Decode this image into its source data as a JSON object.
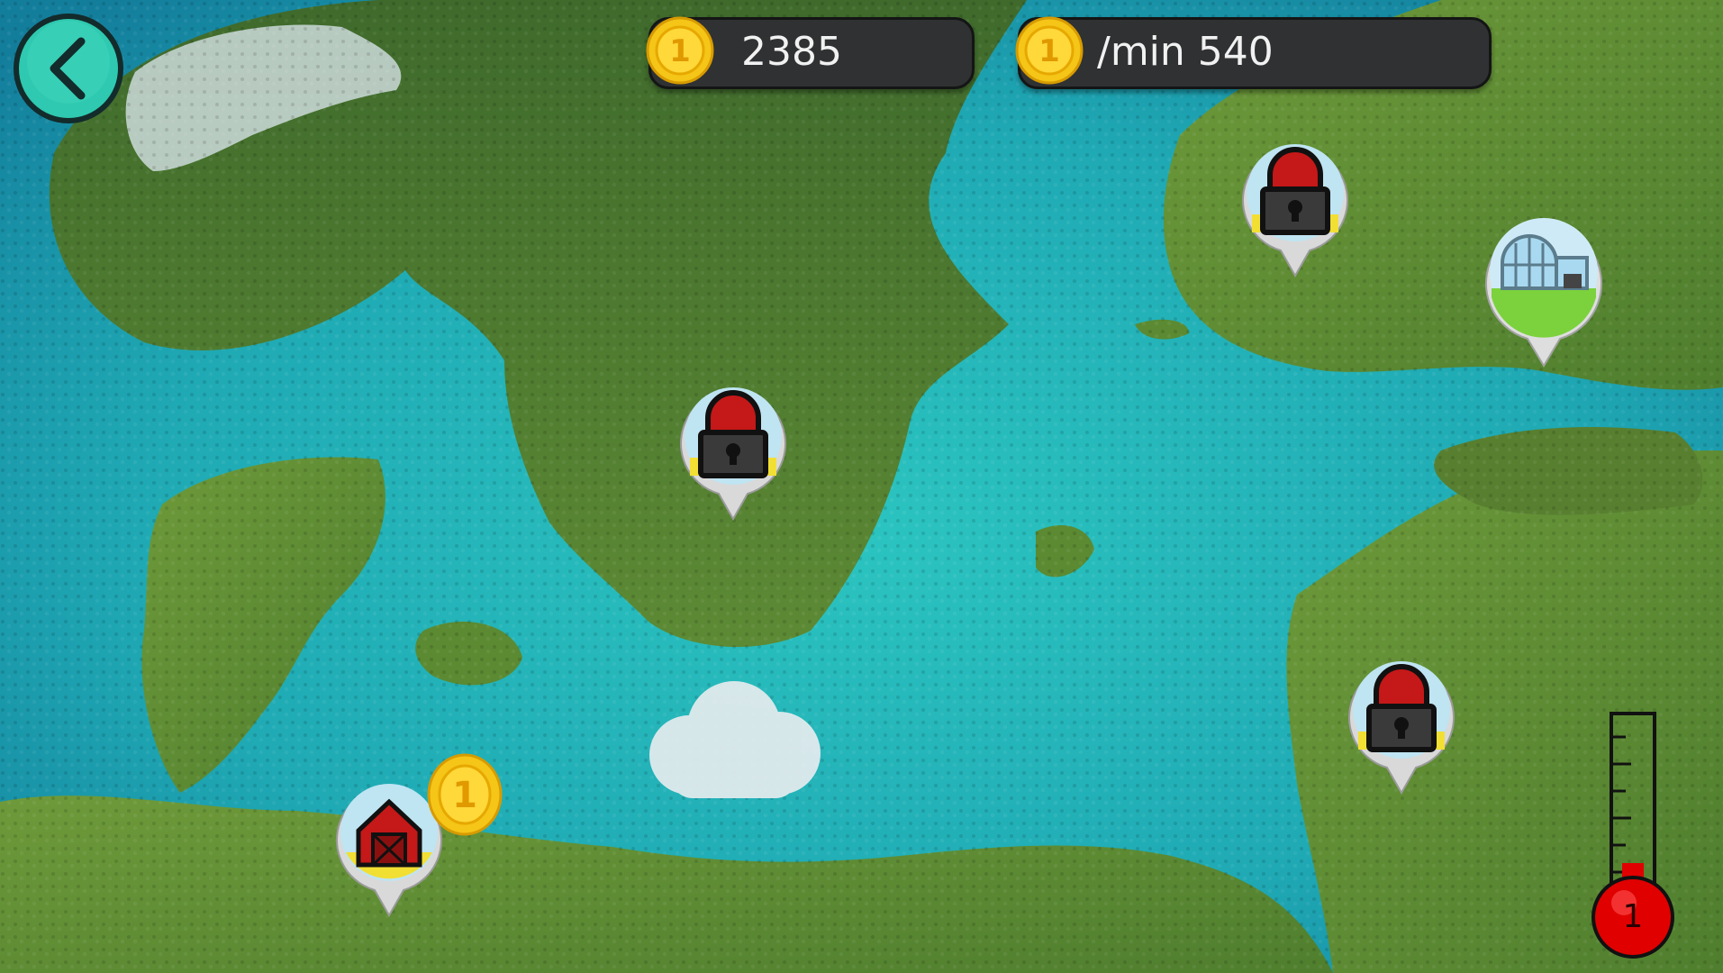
{
  "hud": {
    "coins": "2385",
    "rate": "/min 540",
    "coin_symbol": "1"
  },
  "back_icon": "chevron-left-icon",
  "pins": [
    {
      "name": "locked-region-sweden",
      "state": "locked",
      "icon": "lock-icon"
    },
    {
      "name": "locked-region-finland",
      "state": "locked",
      "icon": "lock-icon"
    },
    {
      "name": "greenhouse-region",
      "state": "unlocked",
      "icon": "greenhouse-icon"
    },
    {
      "name": "locked-region-baltics",
      "state": "locked",
      "icon": "lock-icon"
    },
    {
      "name": "farm-region-germany",
      "state": "unlocked",
      "icon": "barn-icon"
    }
  ],
  "farm_coin_reward": "1",
  "thermometer": {
    "level": "1"
  },
  "colors": {
    "accent": "#2ec9b0",
    "hud_bg": "#2f3133",
    "coin": "#f5c518",
    "lock_red": "#d62020",
    "thermo_red": "#e00000"
  }
}
